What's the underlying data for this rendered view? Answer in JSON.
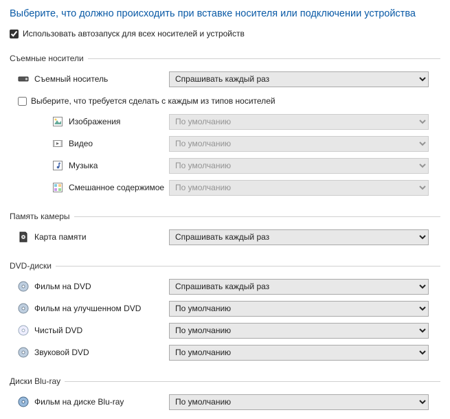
{
  "title": "Выберите, что должно происходить при вставке носителя или подключении устройства",
  "topCheckbox": {
    "label": "Использовать автозапуск для всех носителей и устройств",
    "checked": true
  },
  "opt_ask": "Спрашивать каждый раз",
  "opt_default": "По умолчанию",
  "sec_removable": {
    "title": "Съемные носители",
    "item": "Съемный носитель",
    "subCheck": {
      "label": "Выберите, что требуется сделать с каждым из типов носителей",
      "checked": false
    },
    "types": {
      "images": "Изображения",
      "video": "Видео",
      "music": "Музыка",
      "mixed": "Смешанное содержимое"
    }
  },
  "sec_camera": {
    "title": "Память камеры",
    "item": "Карта памяти"
  },
  "sec_dvd": {
    "title": "DVD-диски",
    "items": {
      "movie": "Фильм на DVD",
      "enhanced": "Фильм на улучшенном DVD",
      "blank": "Чистый DVD",
      "audio": "Звуковой DVD"
    }
  },
  "sec_bluray": {
    "title": "Диски Blu-ray",
    "item": "Фильм на диске Blu-ray"
  }
}
